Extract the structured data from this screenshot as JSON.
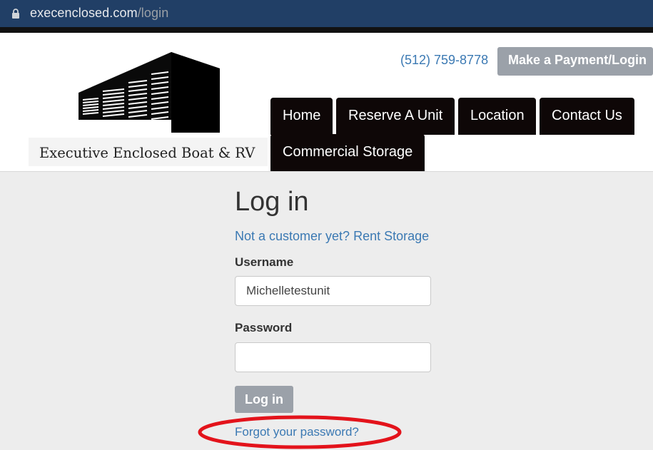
{
  "browser": {
    "url_domain": "execenclosed.com",
    "url_path": "/login",
    "lock_icon": "lock-icon"
  },
  "header": {
    "logo_text": "Executive Enclosed Boat & RV",
    "phone": "(512) 759-8778",
    "payment_button": "Make a Payment/Login",
    "nav": [
      "Home",
      "Reserve A Unit",
      "Location",
      "Contact Us",
      "Commercial Storage"
    ]
  },
  "login": {
    "title": "Log in",
    "signup_link": "Not a customer yet? Rent Storage",
    "username_label": "Username",
    "username_value": "Michelletestunit",
    "password_label": "Password",
    "password_value": "",
    "submit": "Log in",
    "forgot_link": "Forgot your password?"
  },
  "colors": {
    "link": "#3b79b3",
    "nav_bg": "#0e0707",
    "button_bg": "#9ba1a9",
    "highlight": "#e3131b"
  }
}
